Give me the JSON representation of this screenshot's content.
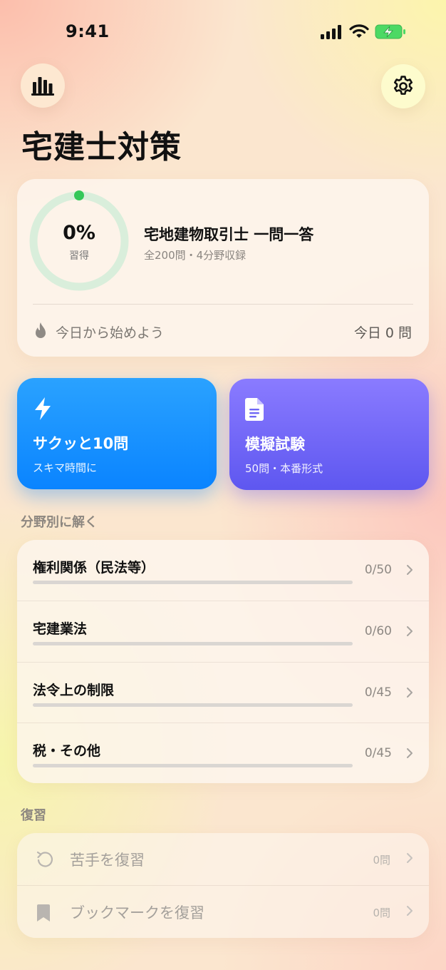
{
  "status_bar": {
    "time": "9:41"
  },
  "header": {
    "title": "宅建士対策"
  },
  "progress": {
    "percent_text": "0%",
    "percent_value": 0,
    "label": "習得",
    "course_title": "宅地建物取引士 一問一答",
    "course_sub": "全200問・4分野収録",
    "streak_text": "今日から始めよう",
    "today_text": "今日 0 問"
  },
  "actions": {
    "quick": {
      "title": "サクッと10問",
      "sub": "スキマ時間に",
      "icon": "bolt-icon"
    },
    "mock": {
      "title": "模擬試験",
      "sub": "50問・本番形式",
      "icon": "document-icon"
    }
  },
  "sections": {
    "fields": "分野別に解く",
    "review": "復習"
  },
  "fields": [
    {
      "name": "権利関係（民法等）",
      "count": "0/50",
      "progress": 0
    },
    {
      "name": "宅建業法",
      "count": "0/60",
      "progress": 0
    },
    {
      "name": "法令上の制限",
      "count": "0/45",
      "progress": 0
    },
    {
      "name": "税・その他",
      "count": "0/45",
      "progress": 0
    }
  ],
  "review": [
    {
      "label": "苦手を復習",
      "count": "0問",
      "icon": "retry-icon"
    },
    {
      "label": "ブックマークを復習",
      "count": "0問",
      "icon": "bookmark-icon"
    }
  ],
  "colors": {
    "quick_accent": "#0a84ff",
    "mock_accent": "#5e57f0",
    "ring_track": "#d9eedb",
    "ring_dot": "#34c759"
  }
}
